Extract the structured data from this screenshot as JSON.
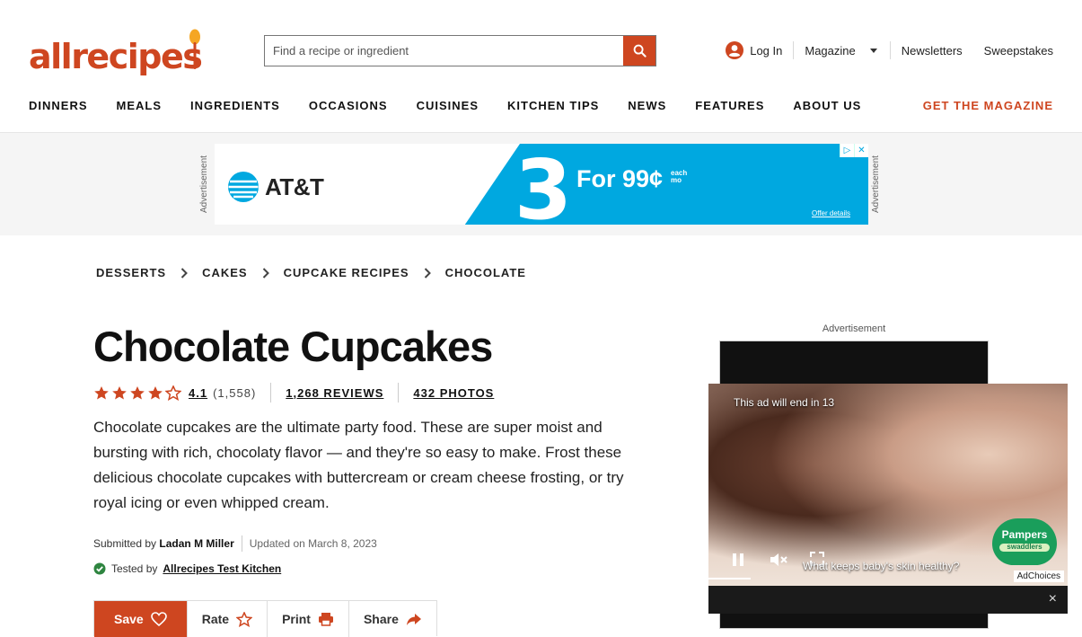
{
  "site": {
    "logo_text": "allrecipes",
    "search_placeholder": "Find a recipe or ingredient",
    "login_label": "Log In",
    "magazine_label": "Magazine",
    "newsletters_label": "Newsletters",
    "sweepstakes_label": "Sweepstakes",
    "get_magazine_label": "GET THE MAGAZINE",
    "nav": [
      "DINNERS",
      "MEALS",
      "INGREDIENTS",
      "OCCASIONS",
      "CUISINES",
      "KITCHEN TIPS",
      "NEWS",
      "FEATURES",
      "ABOUT US"
    ],
    "accent_color": "#ce4620"
  },
  "top_ad": {
    "label": "Advertisement",
    "brand": "AT&T",
    "number": "3",
    "offer": "For 99¢",
    "offer_note": "each mo",
    "details": "Offer details"
  },
  "breadcrumb": [
    "DESSERTS",
    "CAKES",
    "CUPCAKE RECIPES",
    "CHOCOLATE"
  ],
  "recipe": {
    "title": "Chocolate Cupcakes",
    "rating": "4.1",
    "rating_stars": 4.1,
    "rating_count": "(1,558)",
    "reviews_label": "1,268 REVIEWS",
    "photos_label": "432 PHOTOS",
    "description": "Chocolate cupcakes are the ultimate party food. These are super moist and bursting with rich, chocolaty flavor — and they're so easy to make. Frost these delicious chocolate cupcakes with buttercream or cream cheese frosting, or try royal icing or even whipped cream.",
    "submitted_prefix": "Submitted by",
    "author": "Ladan M Miller",
    "updated": "Updated on March 8, 2023",
    "tested_prefix": "Tested by",
    "tested_by": "Allrecipes Test Kitchen",
    "actions": [
      "Save",
      "Rate",
      "Print",
      "Share"
    ]
  },
  "side_ad": {
    "label": "Advertisement",
    "timer_text": "This ad will end in 13",
    "question": "What keeps baby's skin healthy?",
    "brand": "Pampers",
    "brand_sub": "swaddlers",
    "adchoices": "AdChoices",
    "close": "×"
  }
}
